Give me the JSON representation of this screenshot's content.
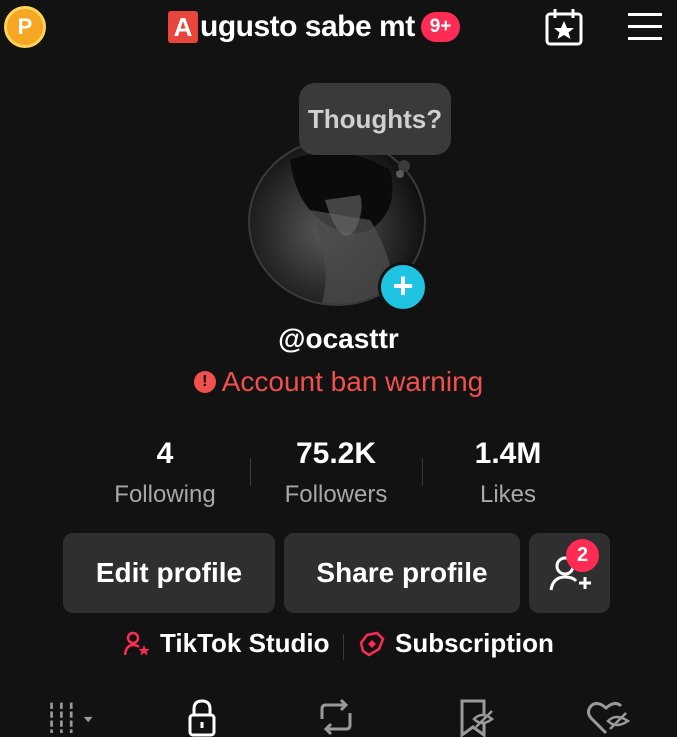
{
  "header": {
    "coin_label": "P",
    "title_prefix": "A",
    "title": "ugusto sabe mt",
    "notification_count": "9+"
  },
  "profile": {
    "bubble_text": "Thoughts?",
    "username": "@ocasttr",
    "warning_text": "Account ban warning",
    "warning_icon": "!"
  },
  "stats": [
    {
      "value": "4",
      "label": "Following"
    },
    {
      "value": "75.2K",
      "label": "Followers"
    },
    {
      "value": "1.4M",
      "label": "Likes"
    }
  ],
  "buttons": {
    "edit": "Edit profile",
    "share": "Share profile",
    "friend_requests_count": "2"
  },
  "links": {
    "studio": "TikTok Studio",
    "subscription": "Subscription"
  },
  "colors": {
    "accent_red": "#fe2c55",
    "warning": "#f1504d",
    "add_blue": "#20c4e3",
    "coin": "#f5a623"
  },
  "icons": [
    "coin-icon",
    "calendar-star-icon",
    "menu-icon",
    "add-friend-icon",
    "studio-icon",
    "subscription-icon",
    "grid-icon",
    "lock-icon",
    "repost-icon",
    "hidden-bookmark-icon",
    "hidden-heart-icon"
  ]
}
